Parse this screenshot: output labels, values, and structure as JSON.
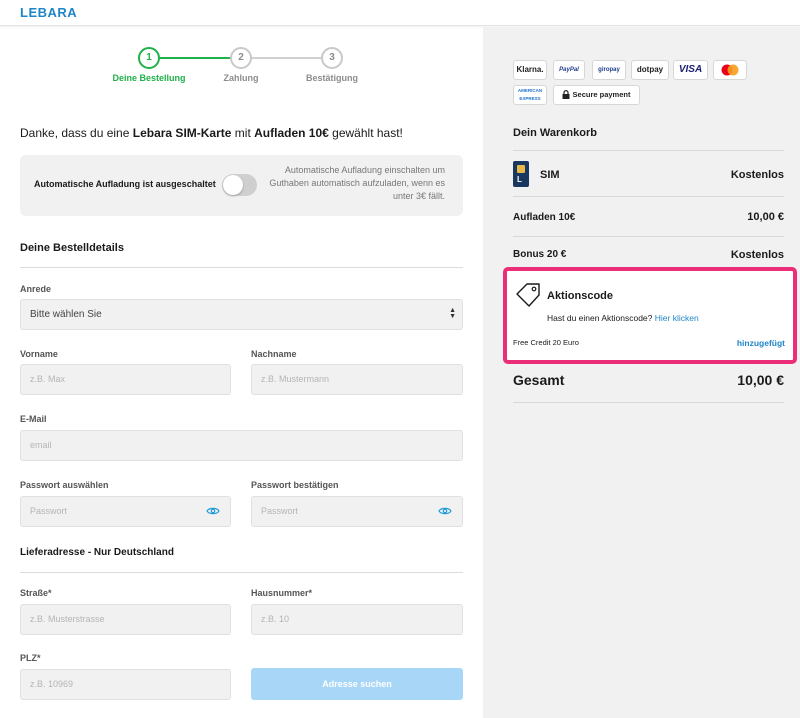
{
  "header": {
    "logo": "LEBARA"
  },
  "stepper": {
    "steps": [
      {
        "number": "1",
        "label": "Deine Bestellung"
      },
      {
        "number": "2",
        "label": "Zahlung"
      },
      {
        "number": "3",
        "label": "Bestätigung"
      }
    ],
    "active_step": 1
  },
  "intro": {
    "prefix": "Danke, dass du eine ",
    "sim": "Lebara SIM-Karte",
    "middle": " mit ",
    "topup": "Aufladen 10€",
    "suffix": " gewählt hast!"
  },
  "auto_topup": {
    "label": "Automatische Aufladung ist ausgeschaltet",
    "enabled": false,
    "description": "Automatische Aufladung einschalten um Guthaben automatisch aufzuladen, wenn es unter 3€ fällt."
  },
  "order_details": {
    "title": "Deine Bestelldetails",
    "salutation": {
      "label": "Anrede",
      "value": "Bitte wählen Sie"
    },
    "first_name": {
      "label": "Vorname",
      "placeholder": "z.B. Max"
    },
    "last_name": {
      "label": "Nachname",
      "placeholder": "z.B. Mustermann"
    },
    "email": {
      "label": "E-Mail",
      "placeholder": "email"
    },
    "password": {
      "label": "Passwort auswählen",
      "placeholder": "Passwort"
    },
    "password_confirm": {
      "label": "Passwort bestätigen",
      "placeholder": "Passwort"
    }
  },
  "delivery": {
    "title": "Lieferadresse - Nur Deutschland",
    "street": {
      "label": "Straße*",
      "placeholder": "z.B. Musterstrasse"
    },
    "house_number": {
      "label": "Hausnummer*",
      "placeholder": "z.B. 10"
    },
    "zip": {
      "label": "PLZ*",
      "placeholder": "z.B. 10969"
    },
    "search_button": "Adresse suchen"
  },
  "payment_logos": [
    "Klarna.",
    "PayPal",
    "giropay",
    "dotpay",
    "VISA",
    "Mastercard",
    "AMERICAN EXPRESS",
    "Secure payment"
  ],
  "cart": {
    "title": "Dein Warenkorb",
    "items": [
      {
        "label": "SIM",
        "value": "Kostenlos"
      },
      {
        "label": "Aufladen 10€",
        "value": "10,00 €"
      },
      {
        "label": "Bonus 20 €",
        "value": "Kostenlos"
      }
    ],
    "promo": {
      "title": "Aktionscode",
      "question": "Hast du einen Aktionscode?",
      "link": "Hier klicken",
      "credit": "Free Credit 20 Euro",
      "added": "hinzugefügt"
    },
    "total_label": "Gesamt",
    "total_value": "10,00 €"
  },
  "colors": {
    "brand_blue": "#1e86c8",
    "step_green": "#20b14a",
    "promo_pink": "#ea2e77",
    "button_disabled": "#a8d6f7"
  }
}
